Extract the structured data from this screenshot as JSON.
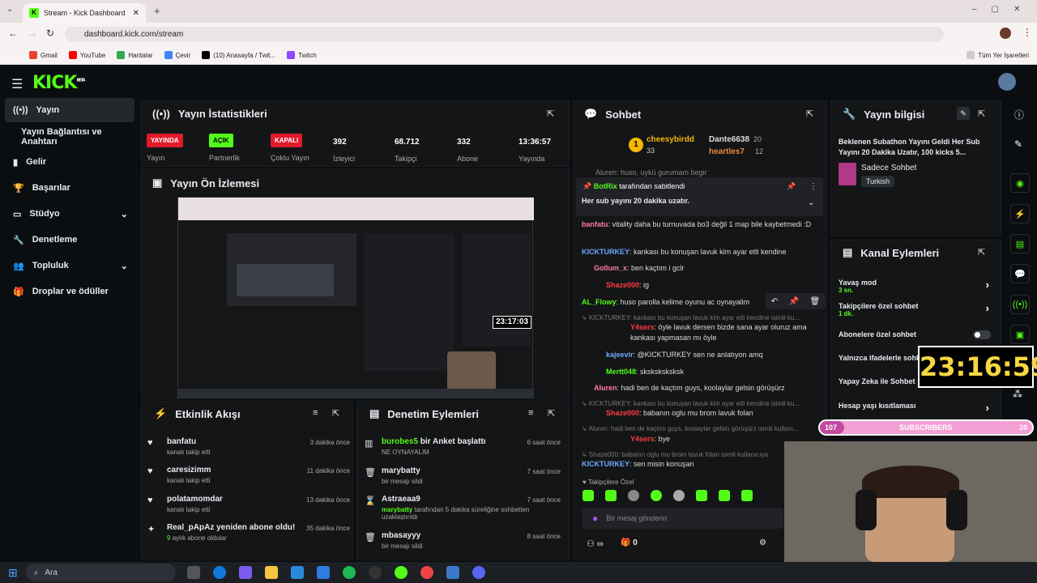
{
  "browser": {
    "tab_title": "Stream - Kick Dashboard",
    "url": "dashboard.kick.com/stream",
    "bookmarks": [
      "Gmail",
      "YouTube",
      "Haritalar",
      "Çevir",
      "(10) Anasayfa / Twit...",
      "Twitch"
    ],
    "all_bookmarks": "Tüm Yer İşaretleri"
  },
  "kick": {
    "logo": "KICK",
    "logo_beta": "BETA"
  },
  "sidebar": {
    "items": [
      "Yayın",
      "Yayın Bağlantısı ve Anahtarı",
      "Gelir",
      "Başarılar",
      "Stüdyo",
      "Denetleme",
      "Topluluk",
      "Droplar ve ödüller"
    ]
  },
  "stats": {
    "title": "Yayın İstatistikleri",
    "yayin_badge": "YAYINDA",
    "yayin_label": "Yayın",
    "partner_badge": "AÇIK",
    "partner_label": "Partnerlik",
    "coklu_badge": "KAPALI",
    "coklu_label": "Çoklu Yayın",
    "viewers": "392",
    "viewers_label": "İzleyici",
    "followers": "68.712",
    "followers_label": "Takipçi",
    "subs": "332",
    "subs_label": "Abone",
    "uptime": "13:36:57",
    "uptime_label": "Yayında"
  },
  "preview": {
    "title": "Yayın Ön İzlemesi",
    "timer": "23:17:03"
  },
  "activity": {
    "title": "Etkinlik Akışı",
    "items": [
      {
        "name": "banfatu",
        "sub": "kanalı takip etti",
        "time": "3 dakika önce"
      },
      {
        "name": "caresizimm",
        "sub": "kanalı takip etti",
        "time": "11 dakika önce"
      },
      {
        "name": "polatamomdar",
        "sub": "kanalı takip etti",
        "time": "13 dakika önce"
      },
      {
        "name": "Real_pApAz yeniden abone oldu!",
        "sub_count": "9",
        "sub": "aylık abone oldular",
        "time": "35 dakika önce"
      }
    ]
  },
  "moderation": {
    "title": "Denetim Eylemleri",
    "items": [
      {
        "name": "burobes5",
        "name2": " bir Anket başlattı",
        "sub": "NE OYNAYALIM",
        "time": "6 saat önce"
      },
      {
        "name": "marybatty",
        "sub": "bir mesajı sildi",
        "time": "7 saat önce"
      },
      {
        "name": "Astraeaa9",
        "sub_user": "marybatty",
        "sub": "tarafından 5 dakika süreliğine sohbetten uzaklaştırıldı",
        "time": "7 saat önce"
      },
      {
        "name": "mbasayyy",
        "sub": "bir mesajı sildi",
        "time": "8 saat önce"
      }
    ]
  },
  "chat": {
    "title": "Sohbet",
    "top1_name": "cheesybirdd",
    "top1_count": "33",
    "top2_name": "Dante6638",
    "top2_count": "20",
    "top3_name": "heartles7",
    "top3_count": "12",
    "pinned_by": "BotRix",
    "pinned_by_suffix": "tarafından sabitlendi",
    "pinned_msg": "Her sub yayını 20 dakika uzatır.",
    "partial_line": "Aluren: huso, uykü gurumam begir",
    "lines": [
      {
        "user": "banfatu",
        "color": "#ff7aa8",
        "msg": ": vitality daha bu turnuvada bo3 değil 1 map bile kaybetmedi :D"
      },
      {
        "user": "KICKTURKEY",
        "color": "#6fa8ff",
        "msg": ": kankası bu konuşan lavuk kim ayar etti kendine"
      },
      {
        "user": "Gollum_x",
        "color": "#ff7aa8",
        "msg": ": ben kaçtım i gclr"
      },
      {
        "user": "Shaze000",
        "color": "#ff3b3b",
        "msg": ": ig"
      },
      {
        "user": "AL_Flowy",
        "color": "#53fc18",
        "msg": ": huso parolla kelime oyunu ac oynayalim"
      },
      {
        "user": "↳ KICKTURKEY: kankası bu konuşan lavuk kim ayar etti kendine isimli ku...",
        "color": "#777",
        "msg": ""
      },
      {
        "user": "Y4sers",
        "color": "#ff3b3b",
        "msg": ": öyle lavuk dersen bizde sana ayar oluruz ama kankası yapmasan mı öyle"
      },
      {
        "user": "kajeevir",
        "color": "#6fa8ff",
        "msg": ": @KICKTURKEY sen ne anlatıyon amq"
      },
      {
        "user": "Mertt048",
        "color": "#53fc18",
        "msg": ": sksksksksksk"
      },
      {
        "user": "Aluren",
        "color": "#ff7aa8",
        "msg": ": hadi ben de kaçtım guys, koolaylar gelsin görüşürz"
      },
      {
        "user": "↳ KICKTURKEY: kankası bu konuşan lavuk kim ayar etti kendine isimli ku...",
        "color": "#777",
        "msg": ""
      },
      {
        "user": "Shaze000",
        "color": "#ff3b3b",
        "msg": ": babanın oglu mu brom lavuk folan"
      },
      {
        "user": "↳ Aluren: hadi ben de kaçtım guys, koolaylar gelsin görüşürz isimli kullanı...",
        "color": "#777",
        "msg": ""
      },
      {
        "user": "Y4sers",
        "color": "#ff3b3b",
        "msg": ": bye"
      },
      {
        "user": "↳ Shaze000: babanın oglu mu brom lavuk folan isimli kullanıcıya",
        "color": "#777",
        "msg": ""
      },
      {
        "user": "KICKTURKEY",
        "color": "#6fa8ff",
        "msg": ": sen misin konuşan"
      }
    ],
    "followers_only": "Takipçilere Özel",
    "placeholder": "Bir mesaj gönderin",
    "points": "0"
  },
  "info": {
    "title": "Yayın bilgisi",
    "stream_title": "Beklenen Subathon Yayını Geldi Her Sub Yayını 20 Dakika Uzatır, 100 kicks 5...",
    "category": "Sadece Sohbet",
    "tag": "Turkish"
  },
  "actions": {
    "title": "Kanal Eylemleri",
    "slow": "Yavaş mod",
    "slow_val": "3 sn.",
    "followers": "Takipçilere özel sohbet",
    "followers_val": "1 dk.",
    "subs": "Abonelere özel sohbet",
    "emotes": "Yalnızca ifadelerle sohbet",
    "ai": "Yapay Zeka ile Sohbet",
    "age": "Hesap yaşı kısıtlaması"
  },
  "overlay": {
    "timer": "23:16:59",
    "subs_left": "107",
    "subs_label": "SUBSCRIBERS",
    "subs_right": "10"
  },
  "taskbar": {
    "search": "Ara"
  },
  "colors": {
    "brand": "#53fc18",
    "live": "#e11b2b"
  }
}
